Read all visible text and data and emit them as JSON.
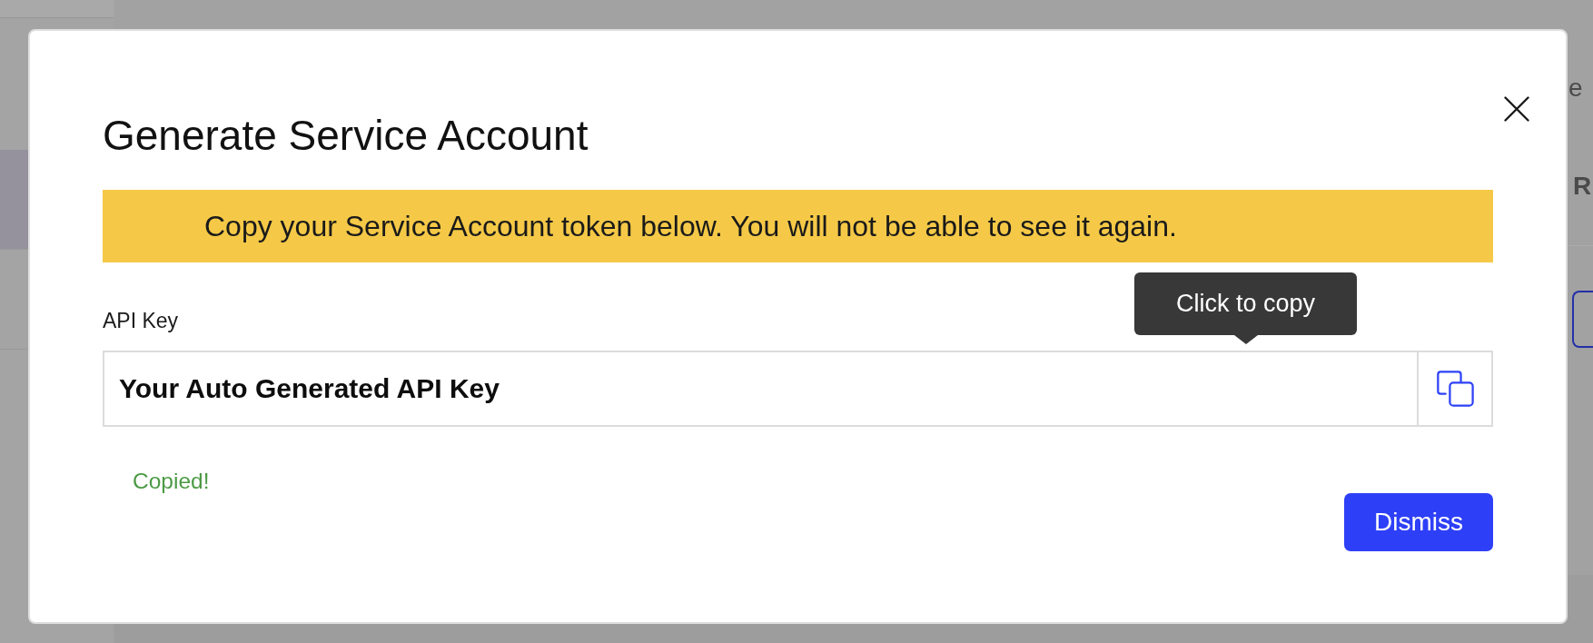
{
  "background_page": {
    "sidebar": {
      "items": [
        {
          "selected": true
        },
        {
          "selected": false
        }
      ]
    },
    "side_text": "e",
    "side_heading": "R"
  },
  "modal": {
    "title": "Generate Service Account",
    "warning": "Copy your Service Account token below. You will not be able to see it again.",
    "field_label": "API Key",
    "api_key_value": "Your Auto Generated API Key",
    "tooltip": "Click to copy",
    "status": "Copied!",
    "dismiss_button": "Dismiss"
  }
}
